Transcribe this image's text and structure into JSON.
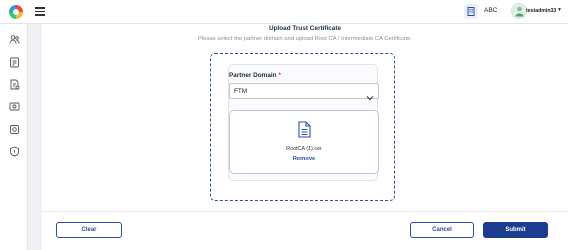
{
  "header": {
    "organization_label": "ABC",
    "username": "testadmin33",
    "icons": [
      "app-logo-icon",
      "hamburger-menu-icon",
      "organization-building-icon",
      "user-avatar-icon",
      "caret-down-icon"
    ]
  },
  "sidebar": {
    "items": [
      {
        "icon": "users-icon"
      },
      {
        "icon": "policy-document-icon"
      },
      {
        "icon": "document-upload-icon"
      },
      {
        "icon": "device-icon"
      },
      {
        "icon": "gear-icon"
      },
      {
        "icon": "shield-icon"
      }
    ]
  },
  "page": {
    "title": "Upload Trust Certificate",
    "subtitle": "Please select the partner domain and upload Root CA / Intermediate CA Certificate."
  },
  "form": {
    "partner_domain_label": "Partner Domain",
    "required_marker": "*",
    "partner_domain_value": "FTM",
    "file_name": "RootCA (1).cer",
    "remove_label": "Remove"
  },
  "actions": {
    "clear_label": "Clear",
    "cancel_label": "Cancel",
    "submit_label": "Submit"
  },
  "colors": {
    "primary": "#1c3d8f",
    "accent_border": "#2c4ea3",
    "required": "#d93025",
    "background": "#f0f1f5"
  }
}
